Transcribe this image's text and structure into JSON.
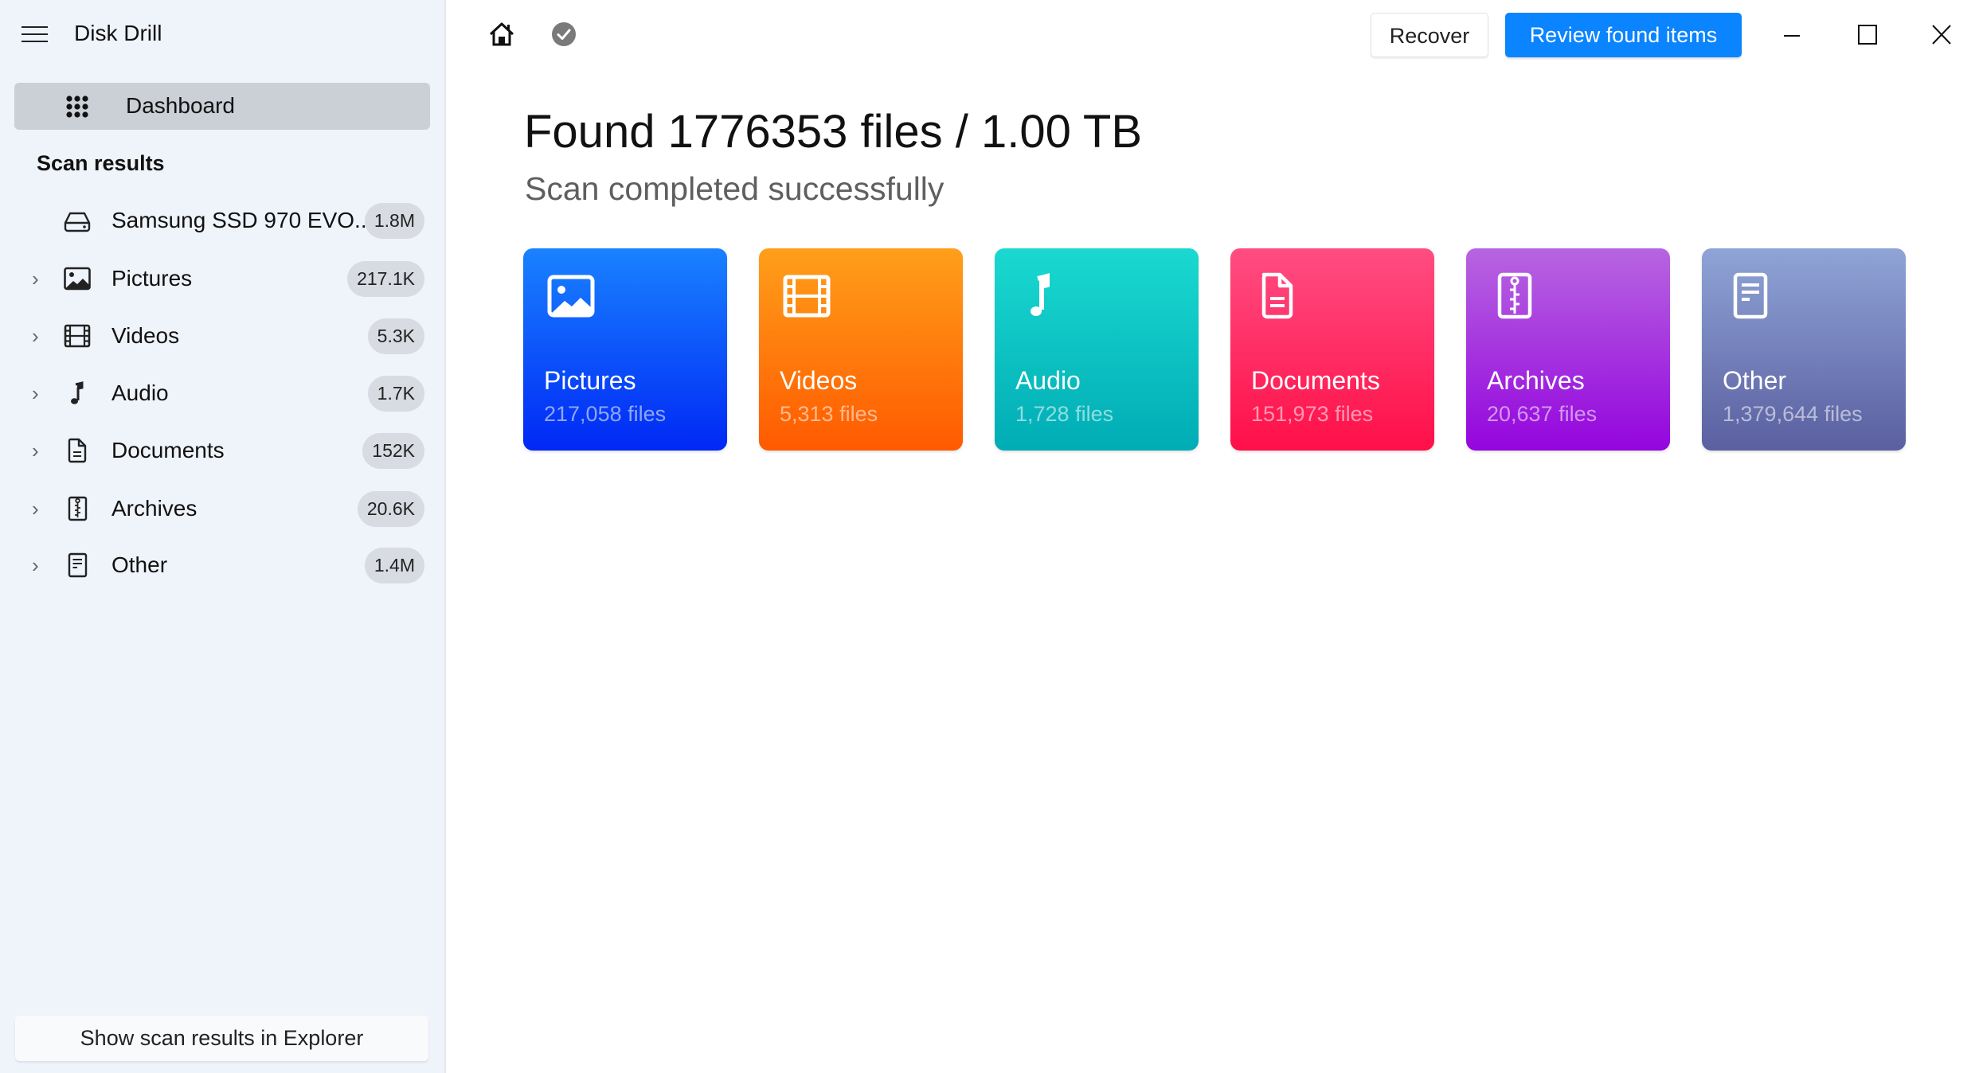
{
  "app": {
    "title": "Disk Drill"
  },
  "sidebar": {
    "dashboard_label": "Dashboard",
    "section_title": "Scan results",
    "items": [
      {
        "label": "Samsung SSD 970 EVO...",
        "badge": "1.8M",
        "icon": "drive-icon",
        "expandable": false
      },
      {
        "label": "Pictures",
        "badge": "217.1K",
        "icon": "picture-icon",
        "expandable": true
      },
      {
        "label": "Videos",
        "badge": "5.3K",
        "icon": "film-icon",
        "expandable": true
      },
      {
        "label": "Audio",
        "badge": "1.7K",
        "icon": "music-note-icon",
        "expandable": true
      },
      {
        "label": "Documents",
        "badge": "152K",
        "icon": "document-icon",
        "expandable": true
      },
      {
        "label": "Archives",
        "badge": "20.6K",
        "icon": "archive-icon",
        "expandable": true
      },
      {
        "label": "Other",
        "badge": "1.4M",
        "icon": "other-file-icon",
        "expandable": true
      }
    ],
    "explorer_button": "Show scan results in Explorer"
  },
  "toolbar": {
    "recover_label": "Recover",
    "review_label": "Review found items",
    "accent_color": "#0a84ff"
  },
  "main": {
    "headline": "Found 1776353 files / 1.00 TB",
    "status": "Scan completed successfully",
    "cards": [
      {
        "name": "Pictures",
        "count": "217,058 files",
        "colors": [
          "#1a82ff",
          "#0028f5"
        ]
      },
      {
        "name": "Videos",
        "count": "5,313 files",
        "colors": [
          "#ff9f1a",
          "#ff5a00"
        ]
      },
      {
        "name": "Audio",
        "count": "1,728 files",
        "colors": [
          "#1ad9d0",
          "#00acb5"
        ]
      },
      {
        "name": "Documents",
        "count": "151,973 files",
        "colors": [
          "#ff4d82",
          "#ff0f48"
        ]
      },
      {
        "name": "Archives",
        "count": "20,637 files",
        "colors": [
          "#b765e0",
          "#9405de"
        ]
      },
      {
        "name": "Other",
        "count": "1,379,644 files",
        "colors": [
          "#8fa4d6",
          "#5a5fa0"
        ]
      }
    ]
  }
}
